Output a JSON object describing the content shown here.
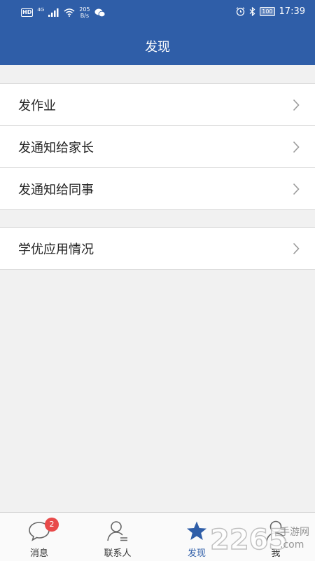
{
  "status_bar": {
    "hd": "HD",
    "network": "4G",
    "speed_value": "205",
    "speed_unit": "B/s",
    "battery": "100",
    "time": "17:39"
  },
  "header": {
    "title": "发现"
  },
  "menu_group_1": [
    {
      "label": "发作业"
    },
    {
      "label": "发通知给家长"
    },
    {
      "label": "发通知给同事"
    }
  ],
  "menu_group_2": [
    {
      "label": "学优应用情况"
    }
  ],
  "tabs": [
    {
      "label": "消息",
      "badge": "2"
    },
    {
      "label": "联系人"
    },
    {
      "label": "发现"
    },
    {
      "label": "我"
    }
  ],
  "colors": {
    "primary": "#2f5ea8",
    "badge": "#e84a4a",
    "background": "#f1f1f1"
  },
  "watermark": {
    "number": "2265",
    "site": "手游网",
    "domain": ".com"
  }
}
